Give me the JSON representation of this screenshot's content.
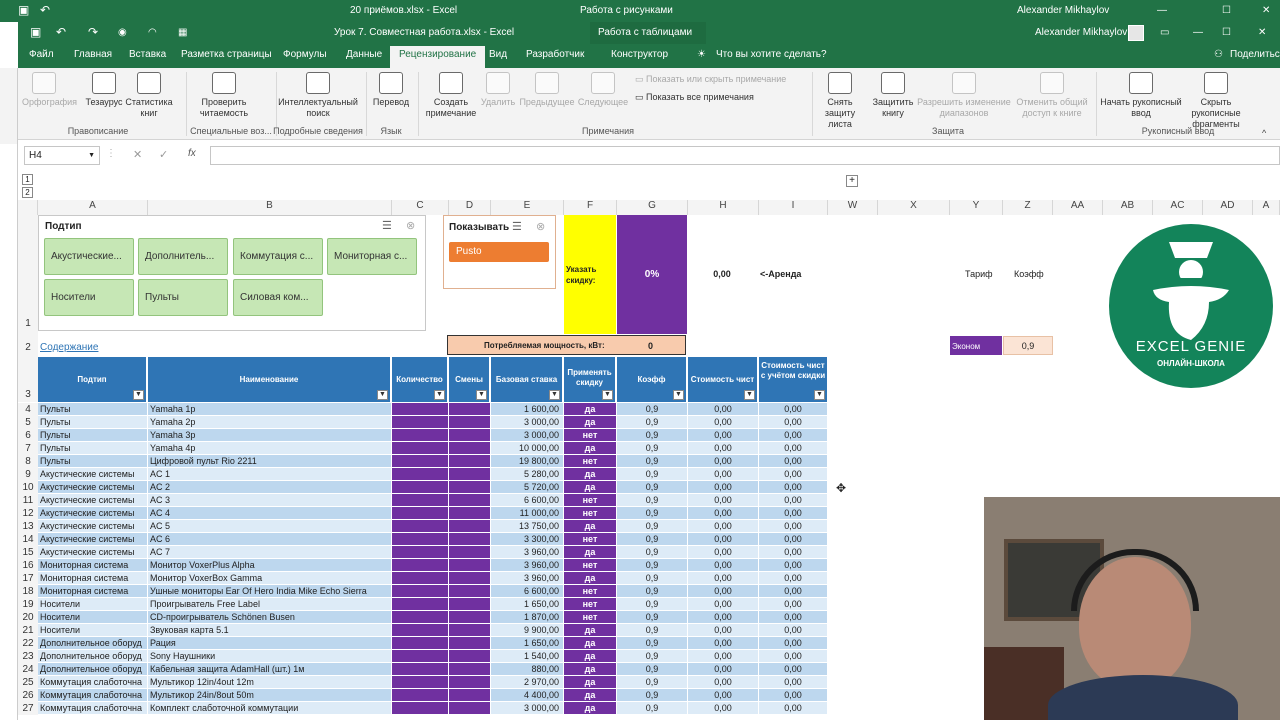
{
  "bg_window": {
    "title": "20 приёмов.xlsx - Excel",
    "context": "Работа с рисунками",
    "user": "Alexander Mikhaylov"
  },
  "window": {
    "title": "Урок 7. Совместная работа.xlsx - Excel",
    "context": "Работа с таблицами",
    "user": "Alexander Mikhaylov"
  },
  "tabs": [
    "Файл",
    "Главная",
    "Вставка",
    "Разметка страницы",
    "Формулы",
    "Данные",
    "Рецензирование",
    "Вид",
    "Разработчик",
    "Конструктор"
  ],
  "tell_me": "Что вы хотите сделать?",
  "share": "Поделиться",
  "ribbon": {
    "spelling": "Орфография",
    "thesaurus": "Тезаурус",
    "stats": "Статистика книг",
    "proofing_group": "Правописание",
    "readability": "Проверить читаемость",
    "special_group": "Специальные воз...",
    "smart_lookup": "Интеллектуальный поиск",
    "insights_group": "Подробные сведения",
    "translate": "Перевод",
    "language_group": "Язык",
    "new_comment": "Создать примечание",
    "delete": "Удалить",
    "previous": "Предыдущее",
    "next": "Следующее",
    "show_hide_comment": "Показать или скрыть примечание",
    "show_all_comments": "Показать все примечания",
    "comments_group": "Примечания",
    "unprotect_sheet": "Снять защиту листа",
    "protect_workbook": "Защитить книгу",
    "allow_edit_ranges": "Разрешить изменение диапазонов",
    "unshare": "Отменить общий доступ к книге",
    "protect_group": "Защита",
    "start_inking": "Начать рукописный ввод",
    "hide_ink": "Скрыть рукописные фрагменты",
    "ink_group": "Рукописный ввод"
  },
  "name_box": "H4",
  "fx": "fx",
  "columns": [
    "A",
    "B",
    "C",
    "D",
    "E",
    "F",
    "G",
    "H",
    "I",
    "W",
    "X",
    "Y",
    "Z",
    "AA",
    "AB",
    "AC",
    "AD",
    "A"
  ],
  "slicer_podtip": {
    "title": "Подтип",
    "items": [
      "Акустические...",
      "Дополнитель...",
      "Коммутация с...",
      "Мониторная с...",
      "Носители",
      "Пульты",
      "Силовая ком..."
    ]
  },
  "slicer_show": {
    "title": "Показывать",
    "item": "Pusto"
  },
  "discount_label": "Указать скидку:",
  "discount_value": "0%",
  "rent_value": "0,00",
  "rent_label": "<-Аренда",
  "tariff_label": "Тариф",
  "coef_label": "Коэфф",
  "tariff_value": "Эконом",
  "tariff_coef": "0,9",
  "contents_link": "Содержание",
  "power_label": "Потребляемая мощность, кВт:",
  "power_value": "0",
  "logo": {
    "name": "EXCEL GENIE",
    "sub": "ОНЛАЙН-ШКОЛА"
  },
  "table_headers": [
    "Подтип",
    "Наименование",
    "Количество",
    "Смены",
    "Базовая ставка",
    "Применять скидку",
    "Коэфф",
    "Стоимость чист",
    "Стоимость чист с учётом скидки"
  ],
  "rows": [
    [
      "4",
      "Пульты",
      "Yamaha 1p",
      "1 600,00",
      "да",
      "0,9",
      "0,00",
      "0,00"
    ],
    [
      "5",
      "Пульты",
      "Yamaha 2p",
      "3 000,00",
      "да",
      "0,9",
      "0,00",
      "0,00"
    ],
    [
      "6",
      "Пульты",
      "Yamaha 3p",
      "3 000,00",
      "нет",
      "0,9",
      "0,00",
      "0,00"
    ],
    [
      "7",
      "Пульты",
      "Yamaha 4p",
      "10 000,00",
      "да",
      "0,9",
      "0,00",
      "0,00"
    ],
    [
      "8",
      "Пульты",
      "Цифровой пульт Rio 2211",
      "19 800,00",
      "нет",
      "0,9",
      "0,00",
      "0,00"
    ],
    [
      "9",
      "Акустические системы",
      "AC 1",
      "5 280,00",
      "да",
      "0,9",
      "0,00",
      "0,00"
    ],
    [
      "10",
      "Акустические системы",
      "AC 2",
      "5 720,00",
      "да",
      "0,9",
      "0,00",
      "0,00"
    ],
    [
      "11",
      "Акустические системы",
      "AC 3",
      "6 600,00",
      "нет",
      "0,9",
      "0,00",
      "0,00"
    ],
    [
      "12",
      "Акустические системы",
      "AC 4",
      "11 000,00",
      "нет",
      "0,9",
      "0,00",
      "0,00"
    ],
    [
      "13",
      "Акустические системы",
      "AC 5",
      "13 750,00",
      "да",
      "0,9",
      "0,00",
      "0,00"
    ],
    [
      "14",
      "Акустические системы",
      "AC 6",
      "3 300,00",
      "нет",
      "0,9",
      "0,00",
      "0,00"
    ],
    [
      "15",
      "Акустические системы",
      "AC 7",
      "3 960,00",
      "да",
      "0,9",
      "0,00",
      "0,00"
    ],
    [
      "16",
      "Мониторная система",
      "Монитор VoxerPlus Alpha",
      "3 960,00",
      "нет",
      "0,9",
      "0,00",
      "0,00"
    ],
    [
      "17",
      "Мониторная система",
      "Монитор VoxerBox Gamma",
      "3 960,00",
      "да",
      "0,9",
      "0,00",
      "0,00"
    ],
    [
      "18",
      "Мониторная система",
      "Ушные мониторы Ear Of Hero India Mike Echo Sierra",
      "6 600,00",
      "нет",
      "0,9",
      "0,00",
      "0,00"
    ],
    [
      "19",
      "Носители",
      "Проигрыватель Free Label",
      "1 650,00",
      "нет",
      "0,9",
      "0,00",
      "0,00"
    ],
    [
      "20",
      "Носители",
      "CD-проигрыватель Schönen Busen",
      "1 870,00",
      "нет",
      "0,9",
      "0,00",
      "0,00"
    ],
    [
      "21",
      "Носители",
      "Звуковая карта 5.1",
      "9 900,00",
      "да",
      "0,9",
      "0,00",
      "0,00"
    ],
    [
      "22",
      "Дополнительное оборуд",
      "Рация",
      "1 650,00",
      "да",
      "0,9",
      "0,00",
      "0,00"
    ],
    [
      "23",
      "Дополнительное оборуд",
      "Sony Наушники",
      "1 540,00",
      "да",
      "0,9",
      "0,00",
      "0,00"
    ],
    [
      "24",
      "Дополнительное оборуд",
      "Кабельная защита AdamHall (шт.) 1м",
      "880,00",
      "да",
      "0,9",
      "0,00",
      "0,00"
    ],
    [
      "25",
      "Коммутация слаботочна",
      "Мультикор 12in/4out 12m",
      "2 970,00",
      "да",
      "0,9",
      "0,00",
      "0,00"
    ],
    [
      "26",
      "Коммутация слаботочна",
      "Мультикор 24in/8out 50m",
      "4 400,00",
      "да",
      "0,9",
      "0,00",
      "0,00"
    ],
    [
      "27",
      "Коммутация слаботочна",
      "Комплект слаботочной коммутации",
      "3 000,00",
      "да",
      "0,9",
      "0,00",
      "0,00"
    ]
  ],
  "colors": {
    "excel_green": "#217346",
    "header_blue": "#2f75b5",
    "row_blue": "#bdd7ee",
    "purple": "#7030a0",
    "yellow": "#ffff00",
    "orange": "#ed7d31",
    "peach": "#f8cbad",
    "slicer_green": "#c6e7b5"
  }
}
